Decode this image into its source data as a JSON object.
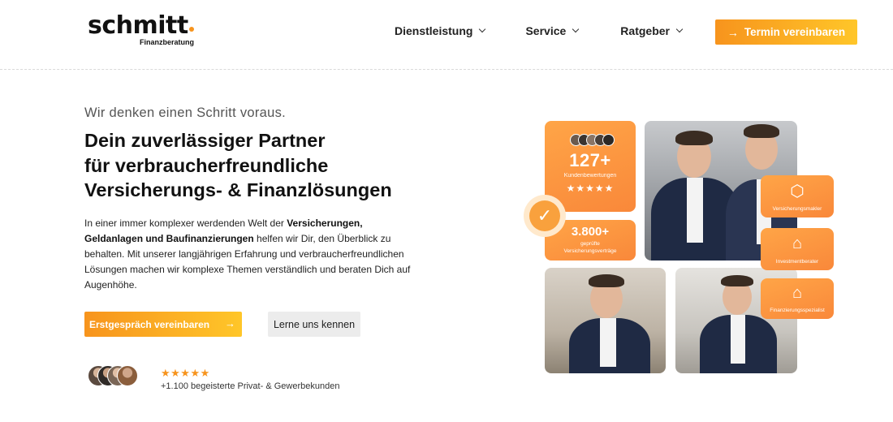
{
  "header": {
    "logo": {
      "word": "schmitt",
      "sub": "Finanzberatung"
    },
    "nav": [
      {
        "label": "Dienstleistung"
      },
      {
        "label": "Service"
      },
      {
        "label": "Ratgeber"
      }
    ],
    "cta_label": "Termin vereinbaren"
  },
  "hero": {
    "tagline": "Wir denken einen Schritt voraus.",
    "headline_lines": [
      "Dein zuverlässiger Partner",
      "für verbraucherfreundliche",
      "Versicherungs- & Finanzlösungen"
    ],
    "body": {
      "p1": "In einer immer komplexer werdenden Welt der ",
      "b1": "Versicherungen,",
      "b2": "Geldanlagen und Baufinanzierungen",
      "p2": " helfen wir Dir, den Überblick zu behalten. Mit unserer langjährigen Erfahrung und verbraucherfreundlichen Lösungen machen wir komplexe Themen verständlich und beraten Dich auf Augenhöhe."
    },
    "primary_button": "Erstgespräch vereinbaren",
    "secondary_button": "Lerne uns kennen",
    "rating_stars": "★★★★★",
    "review_text": "+1.100 begeisterte Privat- & Gewerbekunden"
  },
  "collage": {
    "stat_a": {
      "value": "127+",
      "label": "Kundenbewertungen",
      "stars": "★★★★★"
    },
    "stat_b": {
      "value": "3.800+",
      "label_line1": "geprüfte",
      "label_line2": "Versicherungsverträge"
    },
    "features": [
      {
        "label": "Versicherungsmakler"
      },
      {
        "label": "Investmentberater"
      },
      {
        "label": "Finanzierungsspezialist"
      }
    ]
  },
  "colors": {
    "accent": "#f7941d",
    "accent_light": "#ffc629"
  }
}
